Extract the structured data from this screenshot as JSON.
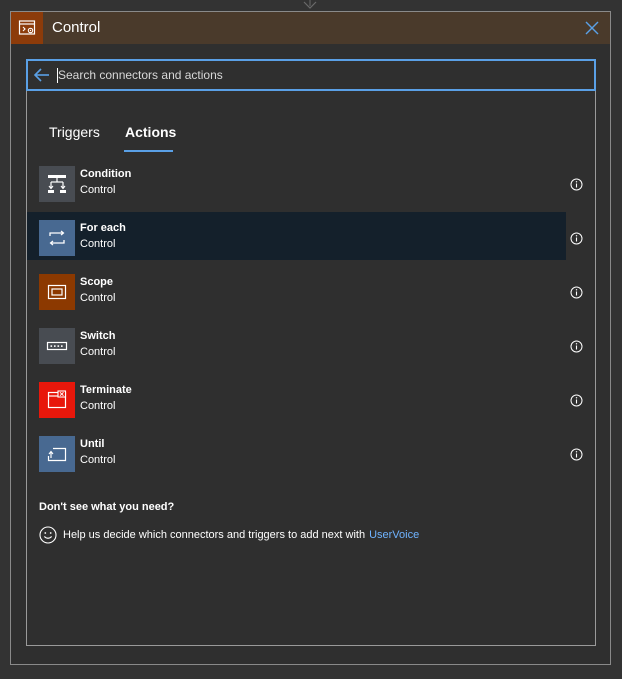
{
  "header": {
    "title": "Control",
    "accent_color": "#8c3b0a",
    "icon": "control-icon"
  },
  "search": {
    "placeholder": "Search connectors and actions",
    "value": ""
  },
  "tabs": [
    {
      "label": "Triggers",
      "selected": false
    },
    {
      "label": "Actions",
      "selected": true
    }
  ],
  "actions": [
    {
      "name": "Condition",
      "connector": "Control",
      "icon": "condition-icon",
      "color": "#484c52",
      "hover": false
    },
    {
      "name": "For each",
      "connector": "Control",
      "icon": "for-each-icon",
      "color": "#486991",
      "hover": true
    },
    {
      "name": "Scope",
      "connector": "Control",
      "icon": "scope-icon",
      "color": "#8c3900",
      "hover": false
    },
    {
      "name": "Switch",
      "connector": "Control",
      "icon": "switch-icon",
      "color": "#484c52",
      "hover": false
    },
    {
      "name": "Terminate",
      "connector": "Control",
      "icon": "terminate-icon",
      "color": "#e8170b",
      "hover": false
    },
    {
      "name": "Until",
      "connector": "Control",
      "icon": "until-icon",
      "color": "#486991",
      "hover": false
    }
  ],
  "footer": {
    "heading": "Don't see what you need?",
    "help_text": "Help us decide which connectors and triggers to add next with",
    "link_label": "UserVoice",
    "link_color": "#6fb3ff"
  },
  "colors": {
    "background": "#333333",
    "header_bar": "#4a3a2b",
    "accent_blue": "#5aa0e6",
    "hover_row": "#14202b"
  }
}
